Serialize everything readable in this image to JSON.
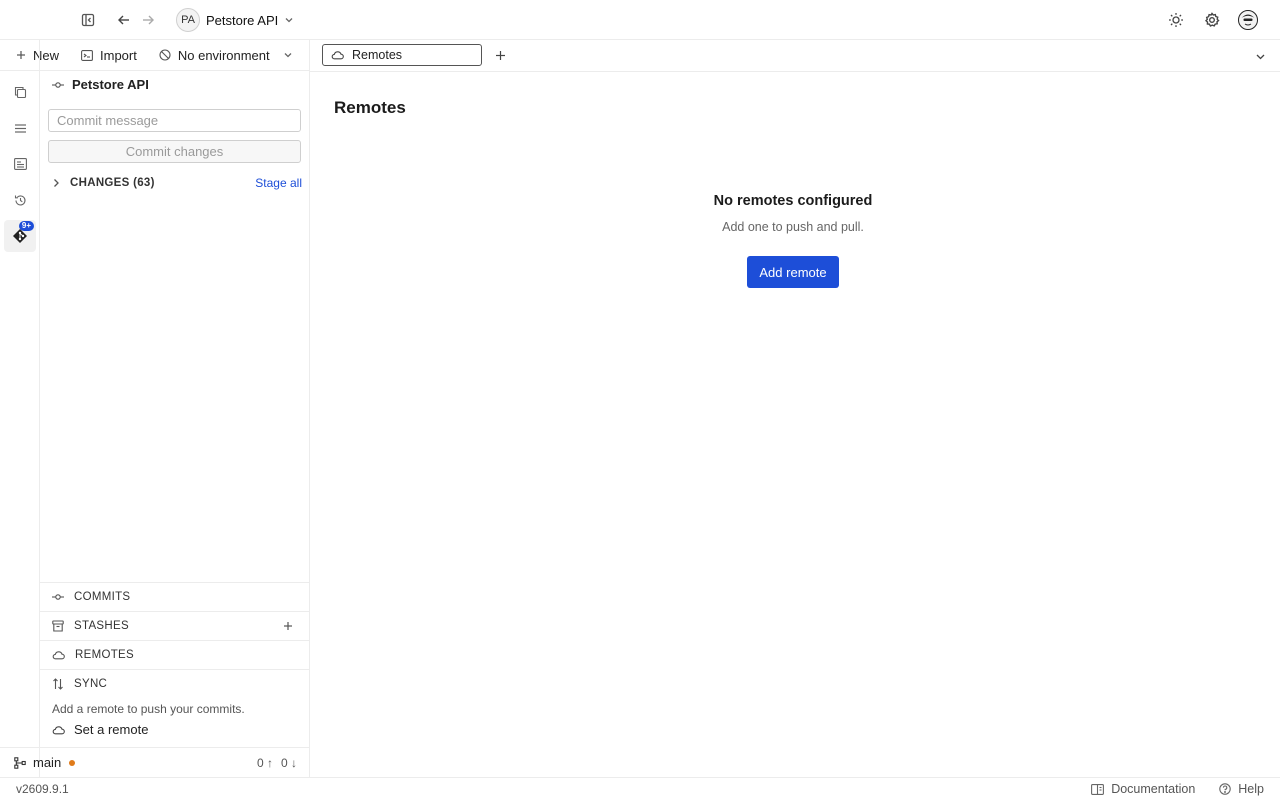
{
  "titlebar": {
    "project_initials": "PA",
    "project_name": "Petstore API"
  },
  "toolbar": {
    "new_label": "New",
    "import_label": "Import",
    "environment_label": "No environment"
  },
  "activity_bar": {
    "git_badge": "9+"
  },
  "sidebar": {
    "header_title": "Petstore API",
    "commit_message_placeholder": "Commit message",
    "commit_button_label": "Commit changes",
    "changes_label": "CHANGES (63)",
    "stage_all_label": "Stage all",
    "sections": {
      "commits": "COMMITS",
      "stashes": "STASHES",
      "remotes": "REMOTES",
      "sync": "SYNC"
    },
    "sync_description": "Add a remote to push your commits.",
    "set_remote_label": "Set a remote",
    "branch": {
      "name": "main",
      "ahead": "0 ↑",
      "behind": "0 ↓"
    }
  },
  "tabs": [
    {
      "label": "Remotes"
    }
  ],
  "main": {
    "title": "Remotes",
    "empty_title": "No remotes configured",
    "empty_subtitle": "Add one to push and pull.",
    "add_remote_label": "Add remote"
  },
  "statusbar": {
    "version": "v2609.9.1",
    "documentation_label": "Documentation",
    "help_label": "Help"
  },
  "colors": {
    "accent": "#1d4ed8",
    "branch_dot": "#e07b1a"
  }
}
